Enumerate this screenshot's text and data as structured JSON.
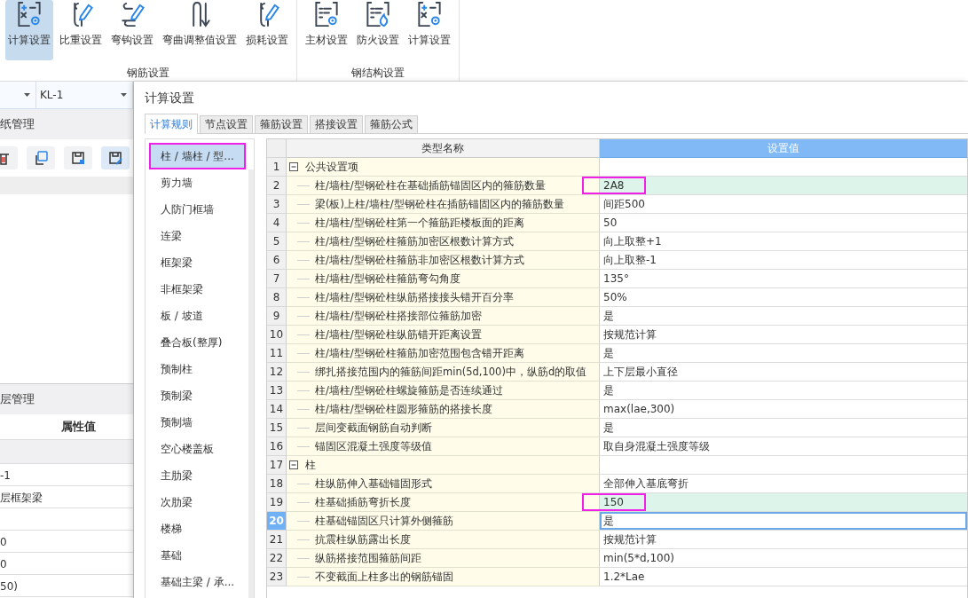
{
  "ribbon": {
    "groups": [
      {
        "label": "钢筋设置",
        "buttons": [
          {
            "label": "计算设置",
            "selected": true
          },
          {
            "label": "比重设置",
            "selected": false
          },
          {
            "label": "弯钩设置",
            "selected": false
          },
          {
            "label": "弯曲调整值设置",
            "selected": false
          },
          {
            "label": "损耗设置",
            "selected": false
          }
        ]
      },
      {
        "label": "钢结构设置",
        "buttons": [
          {
            "label": "主材设置",
            "selected": false
          },
          {
            "label": "防火设置",
            "selected": false
          },
          {
            "label": "计算设置",
            "selected": false
          }
        ]
      }
    ]
  },
  "side_panel": {
    "dropdowns": [
      {
        "value": "KL-1"
      }
    ],
    "top_section": {
      "title": "纸管理"
    },
    "bottom_section": {
      "title": "层管理",
      "column": "属性值",
      "rows": [
        {
          "kind": "group"
        },
        {
          "kind": "value",
          "value": "-1"
        },
        {
          "kind": "value",
          "value": "层框架梁"
        },
        {
          "kind": "value"
        },
        {
          "kind": "value",
          "value": "0"
        },
        {
          "kind": "value",
          "value": "0"
        },
        {
          "kind": "value",
          "value": "50)"
        }
      ]
    }
  },
  "dialog": {
    "title": "计算设置",
    "tabs": [
      {
        "label": "计算规则",
        "selected": true
      },
      {
        "label": "节点设置",
        "selected": false
      },
      {
        "label": "箍筋设置",
        "selected": false
      },
      {
        "label": "搭接设置",
        "selected": false
      },
      {
        "label": "箍筋公式",
        "selected": false
      }
    ],
    "categories": [
      {
        "label": "柱 / 墙柱 / 型...",
        "selected": true,
        "annotated": true
      },
      {
        "label": "剪力墙",
        "selected": false,
        "annotated": false
      },
      {
        "label": "人防门框墙",
        "selected": false,
        "annotated": false
      },
      {
        "label": "连梁",
        "selected": false,
        "annotated": false
      },
      {
        "label": "框架梁",
        "selected": false,
        "annotated": false
      },
      {
        "label": "非框架梁",
        "selected": false,
        "annotated": false
      },
      {
        "label": "板 / 坡道",
        "selected": false,
        "annotated": false
      },
      {
        "label": "叠合板(整厚)",
        "selected": false,
        "annotated": false
      },
      {
        "label": "预制柱",
        "selected": false,
        "annotated": false
      },
      {
        "label": "预制梁",
        "selected": false,
        "annotated": false
      },
      {
        "label": "预制墙",
        "selected": false,
        "annotated": false
      },
      {
        "label": "空心楼盖板",
        "selected": false,
        "annotated": false
      },
      {
        "label": "主肋梁",
        "selected": false,
        "annotated": false
      },
      {
        "label": "次肋梁",
        "selected": false,
        "annotated": false
      },
      {
        "label": "楼梯",
        "selected": false,
        "annotated": false
      },
      {
        "label": "基础",
        "selected": false,
        "annotated": false
      },
      {
        "label": "基础主梁 / 承...",
        "selected": false,
        "annotated": false
      }
    ],
    "grid": {
      "columns": [
        "类型名称",
        "设置值"
      ],
      "rows": [
        {
          "number": "1",
          "kind": "group",
          "name": "公共设置项",
          "expanded": true,
          "selected": false
        },
        {
          "number": "2",
          "kind": "item",
          "name": "柱/墙柱/型钢砼柱在基础插筋锚固区内的箍筋数量",
          "value": "2A8",
          "selected": false,
          "highlighted": true,
          "annotated": true
        },
        {
          "number": "3",
          "kind": "item",
          "name": "梁(板)上柱/墙柱/型钢砼柱在插筋锚固区内的箍筋数量",
          "value": "间距500",
          "selected": false,
          "highlighted": false,
          "annotated": false
        },
        {
          "number": "4",
          "kind": "item",
          "name": "柱/墙柱/型钢砼柱第一个箍筋距楼板面的距离",
          "value": "50",
          "selected": false,
          "highlighted": false,
          "annotated": false
        },
        {
          "number": "5",
          "kind": "item",
          "name": "柱/墙柱/型钢砼柱箍筋加密区根数计算方式",
          "value": "向上取整+1",
          "selected": false,
          "highlighted": false,
          "annotated": false
        },
        {
          "number": "6",
          "kind": "item",
          "name": "柱/墙柱/型钢砼柱箍筋非加密区根数计算方式",
          "value": "向上取整-1",
          "selected": false,
          "highlighted": false,
          "annotated": false
        },
        {
          "number": "7",
          "kind": "item",
          "name": "柱/墙柱/型钢砼柱箍筋弯勾角度",
          "value": "135°",
          "selected": false,
          "highlighted": false,
          "annotated": false
        },
        {
          "number": "8",
          "kind": "item",
          "name": "柱/墙柱/型钢砼柱纵筋搭接接头错开百分率",
          "value": "50%",
          "selected": false,
          "highlighted": false,
          "annotated": false
        },
        {
          "number": "9",
          "kind": "item",
          "name": "柱/墙柱/型钢砼柱搭接部位箍筋加密",
          "value": "是",
          "selected": false,
          "highlighted": false,
          "annotated": false
        },
        {
          "number": "10",
          "kind": "item",
          "name": "柱/墙柱/型钢砼柱纵筋错开距离设置",
          "value": "按规范计算",
          "selected": false,
          "highlighted": false,
          "annotated": false
        },
        {
          "number": "11",
          "kind": "item",
          "name": "柱/墙柱/型钢砼柱箍筋加密范围包含错开距离",
          "value": "是",
          "selected": false,
          "highlighted": false,
          "annotated": false
        },
        {
          "number": "12",
          "kind": "item",
          "name": "绑扎搭接范围内的箍筋间距min(5d,100)中，纵筋d的取值",
          "value": "上下层最小直径",
          "selected": false,
          "highlighted": false,
          "annotated": false
        },
        {
          "number": "13",
          "kind": "item",
          "name": "柱/墙柱/型钢砼柱螺旋箍筋是否连续通过",
          "value": "是",
          "selected": false,
          "highlighted": false,
          "annotated": false
        },
        {
          "number": "14",
          "kind": "item",
          "name": "柱/墙柱/型钢砼柱圆形箍筋的搭接长度",
          "value": "max(lae,300)",
          "selected": false,
          "highlighted": false,
          "annotated": false
        },
        {
          "number": "15",
          "kind": "item",
          "name": "层间变截面钢筋自动判断",
          "value": "是",
          "selected": false,
          "highlighted": false,
          "annotated": false
        },
        {
          "number": "16",
          "kind": "item",
          "name": "锚固区混凝土强度等级值",
          "value": "取自身混凝土强度等级",
          "selected": false,
          "highlighted": false,
          "annotated": false
        },
        {
          "number": "17",
          "kind": "group",
          "name": "柱",
          "expanded": true,
          "selected": false
        },
        {
          "number": "18",
          "kind": "item",
          "name": "柱纵筋伸入基础锚固形式",
          "value": "全部伸入基底弯折",
          "selected": false,
          "highlighted": false,
          "annotated": false
        },
        {
          "number": "19",
          "kind": "item",
          "name": "柱基础插筋弯折长度",
          "value": "150",
          "selected": false,
          "highlighted": true,
          "annotated": true
        },
        {
          "number": "20",
          "kind": "item",
          "name": "柱基础锚固区只计算外侧箍筋",
          "value": "是",
          "selected": true,
          "highlighted": false,
          "annotated": false
        },
        {
          "number": "21",
          "kind": "item",
          "name": "抗震柱纵筋露出长度",
          "value": "按规范计算",
          "selected": false,
          "highlighted": false,
          "annotated": false
        },
        {
          "number": "22",
          "kind": "item",
          "name": "纵筋搭接范围箍筋间距",
          "value": "min(5*d,100)",
          "selected": false,
          "highlighted": false,
          "annotated": false
        },
        {
          "number": "23",
          "kind": "item",
          "name": "不变截面上柱多出的钢筋锚固",
          "value": "1.2*Lae",
          "selected": false,
          "highlighted": false,
          "annotated": false
        }
      ]
    }
  }
}
